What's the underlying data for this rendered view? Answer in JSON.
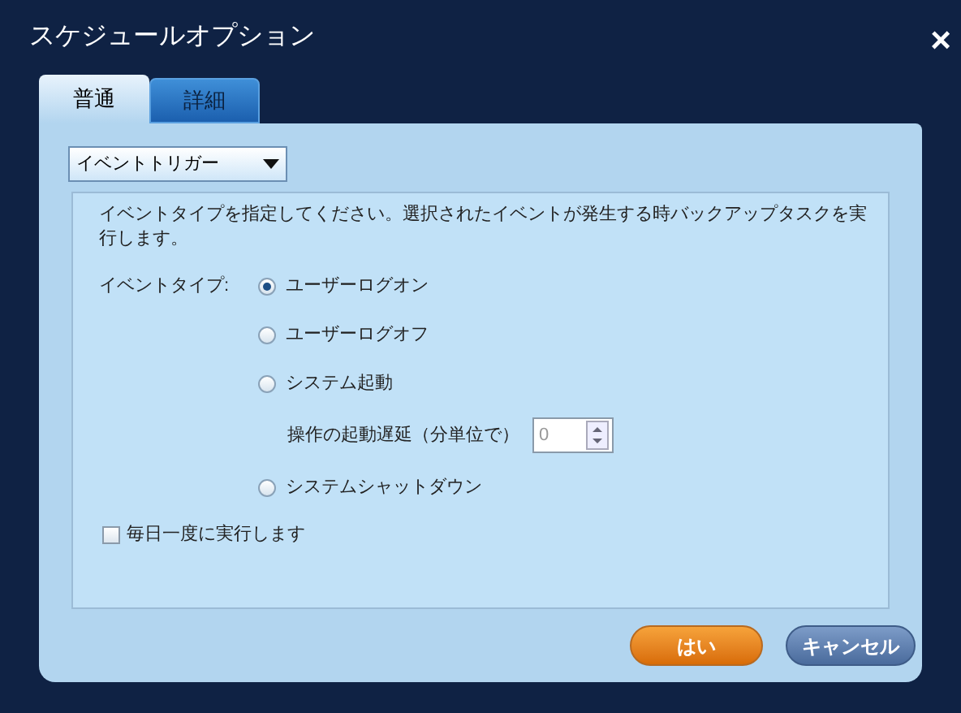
{
  "window": {
    "title": "スケジュールオプション",
    "close": "×"
  },
  "tabs": [
    {
      "label": "普通",
      "selected": true
    },
    {
      "label": "詳細",
      "selected": false
    }
  ],
  "trigger_dropdown": {
    "value": "イベントトリガー"
  },
  "description": "イベントタイプを指定してください。選択されたイベントが発生する時バックアップタスクを実行します。",
  "event_type_label": "イベントタイプ:",
  "event_types": [
    {
      "kind": "radio",
      "label": "ユーザーログオン",
      "selected": true
    },
    {
      "kind": "radio",
      "label": "ユーザーログオフ",
      "selected": false
    },
    {
      "kind": "radio",
      "label": "システム起動",
      "selected": false
    },
    {
      "kind": "delay",
      "label": "操作の起動遅延（分単位で）",
      "value": "0"
    },
    {
      "kind": "radio",
      "label": "システムシャットダウン",
      "selected": false
    }
  ],
  "run_once_daily": {
    "label": "毎日一度に実行します",
    "checked": false
  },
  "buttons": [
    {
      "kind": "primary",
      "label": "はい"
    },
    {
      "kind": "secondary",
      "label": "キャンセル"
    }
  ]
}
